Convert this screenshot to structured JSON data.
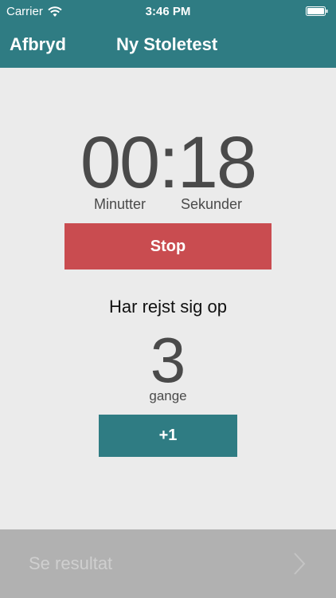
{
  "status_bar": {
    "carrier": "Carrier",
    "time": "3:46 PM"
  },
  "nav": {
    "left_label": "Afbryd",
    "title": "Ny Stoletest"
  },
  "timer": {
    "display": "00:18",
    "minutes_label": "Minutter",
    "seconds_label": "Sekunder",
    "stop_label": "Stop"
  },
  "counter": {
    "label": "Har rejst sig op",
    "value": "3",
    "unit": "gange",
    "increment_label": "+1"
  },
  "footer": {
    "result_label": "Se resultat"
  },
  "colors": {
    "teal": "#2f7c83",
    "red": "#c94c50",
    "background": "#ebebeb",
    "disabled": "#b1b1b1"
  }
}
